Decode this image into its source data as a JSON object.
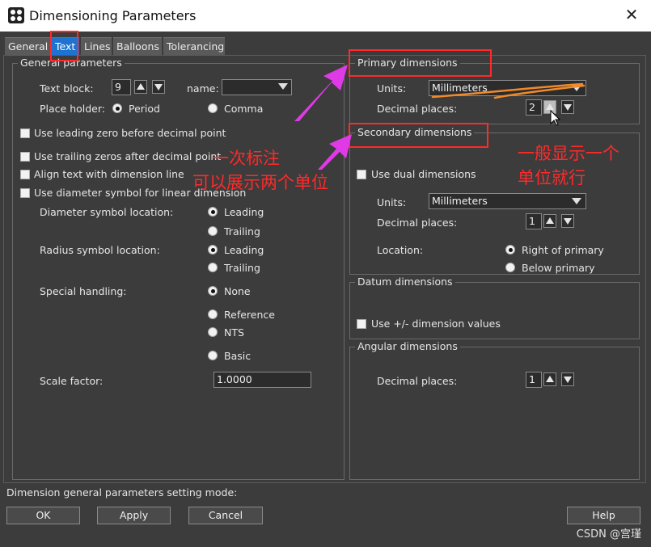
{
  "window": {
    "title": "Dimensioning Parameters",
    "close_glyph": "✕"
  },
  "tabs": [
    "General",
    "Text",
    "Lines",
    "Balloons",
    "Tolerancing"
  ],
  "general": {
    "title": "General parameters",
    "text_block_label": "Text block:",
    "text_block_value": "9",
    "name_label": "name:",
    "name_value": "",
    "place_holder_label": "Place holder:",
    "period": "Period",
    "comma": "Comma",
    "leading_zero": "Use leading zero before decimal point",
    "trailing_zeros": "Use trailing zeros after decimal point",
    "align_text": "Align text with dimension line",
    "diameter_symbol": "Use diameter symbol for linear dimension",
    "diameter_location_label": "Diameter symbol location:",
    "radius_location_label": "Radius symbol location:",
    "leading": "Leading",
    "trailing": "Trailing",
    "special_label": "Special handling:",
    "none": "None",
    "reference": "Reference",
    "nts": "NTS",
    "basic": "Basic",
    "scale_label": "Scale factor:",
    "scale_value": "1.0000"
  },
  "primary": {
    "title": "Primary dimensions",
    "units_label": "Units:",
    "units_value": "Millimeters",
    "decimal_label": "Decimal places:",
    "decimal_value": "2"
  },
  "secondary": {
    "title": "Secondary dimensions",
    "dual_label": "Use dual dimensions",
    "units_label": "Units:",
    "units_value": "Millimeters",
    "decimal_label": "Decimal places:",
    "decimal_value": "1",
    "location_label": "Location:",
    "right_of_primary": "Right of primary",
    "below_primary": "Below primary"
  },
  "datum": {
    "title": "Datum dimensions",
    "plusminus_label": "Use +/- dimension values"
  },
  "angular": {
    "title": "Angular dimensions",
    "decimal_label": "Decimal places:",
    "decimal_value": "1"
  },
  "status_text": "Dimension general parameters setting mode:",
  "buttons": {
    "ok": "OK",
    "apply": "Apply",
    "cancel": "Cancel",
    "help": "Help"
  },
  "annotations": {
    "line1": "一次标注",
    "line2": "可以展示两个单位",
    "line3": "一般显示一个",
    "line4": "单位就行"
  },
  "watermark": "CSDN @宫瑾",
  "colors": {
    "accent": "#1e73d0",
    "annotation": "#ff2a2a",
    "arrow": "#e03ae6",
    "highlight": "#f08a2a"
  }
}
